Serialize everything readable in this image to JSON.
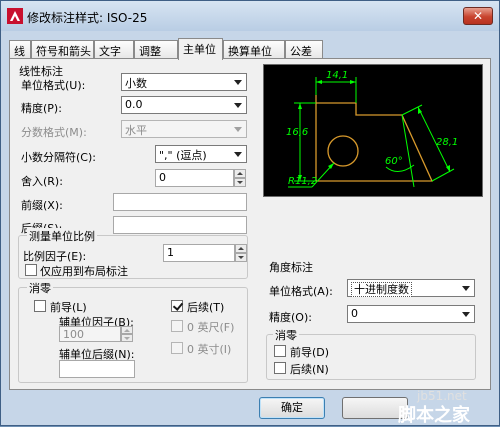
{
  "window": {
    "title": "修改标注样式: ISO-25",
    "close": "✕"
  },
  "tabs": [
    "线",
    "符号和箭头",
    "文字",
    "调整",
    "主单位",
    "换算单位",
    "公差"
  ],
  "linear": {
    "title": "线性标注",
    "unit_format_label": "单位格式(U):",
    "unit_format_value": "小数",
    "precision_label": "精度(P):",
    "precision_value": "0.0",
    "fraction_format_label": "分数格式(M):",
    "fraction_format_value": "水平",
    "decimal_sep_label": "小数分隔符(C):",
    "decimal_sep_value": "\",\" (逗点)",
    "round_label": "舍入(R):",
    "round_value": "0",
    "prefix_label": "前缀(X):",
    "prefix_value": "",
    "suffix_label": "后缀(S):",
    "suffix_value": ""
  },
  "scale": {
    "title": "测量单位比例",
    "factor_label": "比例因子(E):",
    "factor_value": "1",
    "layout_only_label": "仅应用到布局标注"
  },
  "zero": {
    "title": "消零",
    "leading_label": "前导(L)",
    "trailing_label": "后续(T)",
    "sub_factor_label": "辅单位因子(B):",
    "sub_factor_value": "100",
    "sub_suffix_label": "辅单位后缀(N):",
    "sub_suffix_value": "",
    "feet_label": "0 英尺(F)",
    "inches_label": "0 英寸(I)"
  },
  "angular": {
    "title": "角度标注",
    "unit_format_label": "单位格式(A):",
    "unit_format_value": "十进制度数",
    "precision_label": "精度(O):",
    "precision_value": "0",
    "zero_title": "消零",
    "leading_label": "前导(D)",
    "trailing_label": "后续(N)"
  },
  "preview": {
    "dim_top": "14,1",
    "dim_left": "16,6",
    "dim_right": "28,1",
    "angle": "60°",
    "radius": "R11,2"
  },
  "buttons": {
    "ok": "确定",
    "cancel": ""
  },
  "watermark": {
    "line1": "jb51.net",
    "line2": "脚本之家"
  },
  "colors": {
    "dim_line": "#00ff00",
    "object_line": "#e0a030"
  }
}
